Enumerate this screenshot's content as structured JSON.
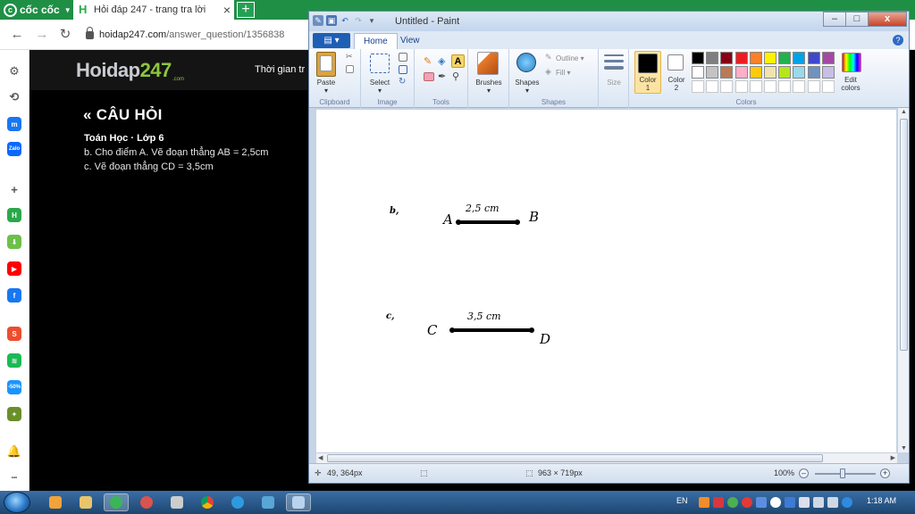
{
  "browser": {
    "brand": "cốc cốc",
    "tab_title": "Hỏi đáp 247 - trang tra lời",
    "tab_close": "×",
    "new_tab": "+",
    "nav": {
      "back": "←",
      "forward": "→",
      "reload": "↻"
    },
    "url_host": "hoidap247.com",
    "url_path": "/answer_question/1356838"
  },
  "sidebar": {
    "items": [
      {
        "name": "settings-icon",
        "glyph": "⚙"
      },
      {
        "name": "history-icon",
        "glyph": "⟲"
      },
      {
        "name": "messenger-icon",
        "glyph": "m",
        "color": "#1877f2"
      },
      {
        "name": "zalo-icon",
        "glyph": "Zalo",
        "color": "#0a68ff"
      },
      {
        "name": "add-icon",
        "glyph": "+"
      },
      {
        "name": "hoidap-icon",
        "glyph": "H",
        "color": "#2aa84a"
      },
      {
        "name": "download-icon",
        "glyph": "⬇",
        "color": "#6cc04a"
      },
      {
        "name": "youtube-icon",
        "glyph": "▶",
        "color": "#ff0000"
      },
      {
        "name": "facebook-icon",
        "glyph": "f",
        "color": "#1877f2"
      },
      {
        "name": "shopee-icon",
        "glyph": "S",
        "color": "#ee4d2d"
      },
      {
        "name": "spotify-icon",
        "glyph": "≋",
        "color": "#1db954"
      },
      {
        "name": "tiki-icon",
        "glyph": "-50%",
        "color": "#1a94ff"
      },
      {
        "name": "game-icon",
        "glyph": "✦",
        "color": "#6a8f2a"
      },
      {
        "name": "notification-icon",
        "glyph": "🔔"
      },
      {
        "name": "more-icon",
        "glyph": "•••"
      }
    ]
  },
  "webpage": {
    "logo_main": "Hoidap",
    "logo_num": "247",
    "logo_sub": ".com",
    "header_text": "Thời gian tr",
    "question_heading": "« CÂU HỎI",
    "subject": "Toán Học · Lớp 6",
    "lines": [
      "b. Cho điểm A. Vẽ đoạn thẳng AB = 2,5cm",
      "c. Vẽ đoạn thẳng CD = 3,5cm"
    ]
  },
  "paint": {
    "title": "Untitled - Paint",
    "window_buttons": {
      "minimize": "–",
      "maximize": "□",
      "close": "x"
    },
    "file_button": "▤ ▾",
    "tabs": [
      "Home",
      "View"
    ],
    "help": "?",
    "groups": {
      "clipboard": "Clipboard",
      "image": "Image",
      "tools": "Tools",
      "shapes": "Shapes",
      "colors": "Colors"
    },
    "buttons": {
      "paste": "Paste",
      "select": "Select",
      "brushes": "Brushes",
      "shapes": "Shapes",
      "outline": "Outline",
      "fill": "Fill",
      "size": "Size",
      "color1": "Color\n1",
      "color2": "Color\n2",
      "edit_colors": "Edit\ncolors"
    },
    "palette_row1": [
      "#000000",
      "#7f7f7f",
      "#880015",
      "#ed1c24",
      "#ff7f27",
      "#fff200",
      "#22b14c",
      "#00a2e8",
      "#3f48cc",
      "#a349a4"
    ],
    "palette_row2": [
      "#ffffff",
      "#c3c3c3",
      "#b97a57",
      "#ffaec9",
      "#ffc90e",
      "#efe4b0",
      "#b5e61d",
      "#99d9ea",
      "#7092be",
      "#c8bfe7"
    ],
    "color1": "#000000",
    "color2": "#ffffff",
    "drawing": {
      "label_b": "b,",
      "label_c": "c,",
      "A": "A",
      "B": "B",
      "C": "C",
      "D": "D",
      "ab_length": "2,5 cm",
      "cd_length": "3,5 cm"
    },
    "status": {
      "cursor_pos": "49, 364px",
      "image_size": "963 × 719px",
      "zoom": "100%",
      "zoom_out": "–",
      "zoom_in": "+"
    }
  },
  "taskbar": {
    "lang": "EN",
    "time": "1:18 AM"
  }
}
